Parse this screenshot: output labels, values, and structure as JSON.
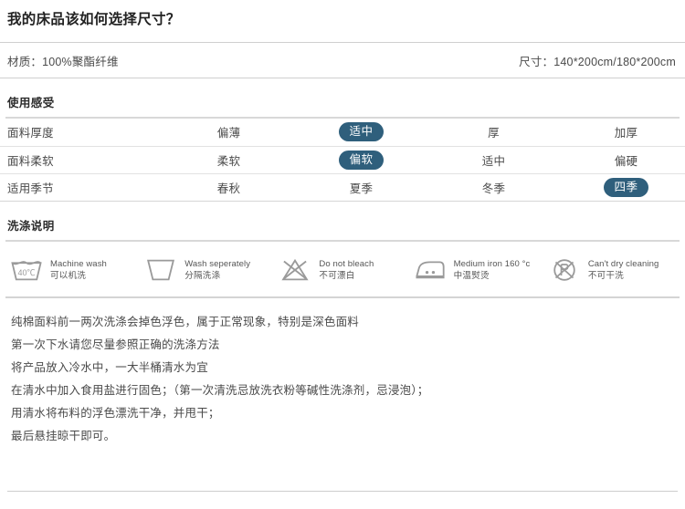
{
  "header": {
    "title": "我的床品该如何选择尺寸？"
  },
  "spec": {
    "material_label": "材质：",
    "material_value": "100%聚酯纤维",
    "material_full": "材质：100%聚酯纤维",
    "size_label": "尺寸：",
    "size_value": "140*200cm/180*200cm",
    "size_full": "尺寸：140*200cm/180*200cm"
  },
  "feel": {
    "section_title": "使用感受",
    "rows": [
      {
        "label": "面料厚度",
        "options": [
          {
            "text": "偏薄",
            "selected": false
          },
          {
            "text": "适中",
            "selected": true
          },
          {
            "text": "厚",
            "selected": false
          },
          {
            "text": "加厚",
            "selected": false
          }
        ]
      },
      {
        "label": "面料柔软",
        "options": [
          {
            "text": "柔软",
            "selected": false
          },
          {
            "text": "偏软",
            "selected": true
          },
          {
            "text": "适中",
            "selected": false
          },
          {
            "text": "偏硬",
            "selected": false
          }
        ]
      },
      {
        "label": "适用季节",
        "options": [
          {
            "text": "春秋",
            "selected": false
          },
          {
            "text": "夏季",
            "selected": false
          },
          {
            "text": "冬季",
            "selected": false
          },
          {
            "text": "四季",
            "selected": true
          }
        ]
      }
    ]
  },
  "care": {
    "section_title": "洗涤说明",
    "items": [
      {
        "icon": "machine-wash-40c-icon",
        "en": "Machine wash",
        "cn": "可以机洗"
      },
      {
        "icon": "wash-separately-icon",
        "en": "Wash seperately",
        "cn": "分隔洗涤"
      },
      {
        "icon": "do-not-bleach-icon",
        "en": "Do not bleach",
        "cn": "不可漂白"
      },
      {
        "icon": "medium-iron-icon",
        "en": "Medium iron 160 °c",
        "cn": "中温熨烫"
      },
      {
        "icon": "no-dry-cleaning-icon",
        "en": "Can't dry cleaning",
        "cn": "不可干洗"
      }
    ],
    "wash_temp_label": "40℃"
  },
  "notes": {
    "lines": [
      "纯棉面料前一两次洗涤会掉色浮色，属于正常现象，特别是深色面料",
      "第一次下水请您尽量参照正确的洗涤方法",
      "将产品放入冷水中，一大半桶清水为宜",
      "在清水中加入食用盐进行固色；（第一次清洗忌放洗衣粉等碱性洗涤剂，忌浸泡）；",
      "用清水将布料的浮色漂洗干净，并甩干；",
      "最后悬挂晾干即可。"
    ]
  },
  "colors": {
    "pill_background": "#2f5f7c",
    "pill_text": "#ffffff",
    "icon_stroke": "#9a9a9a",
    "rule": "#d4d4d4",
    "body_text": "#4a4a4a"
  }
}
